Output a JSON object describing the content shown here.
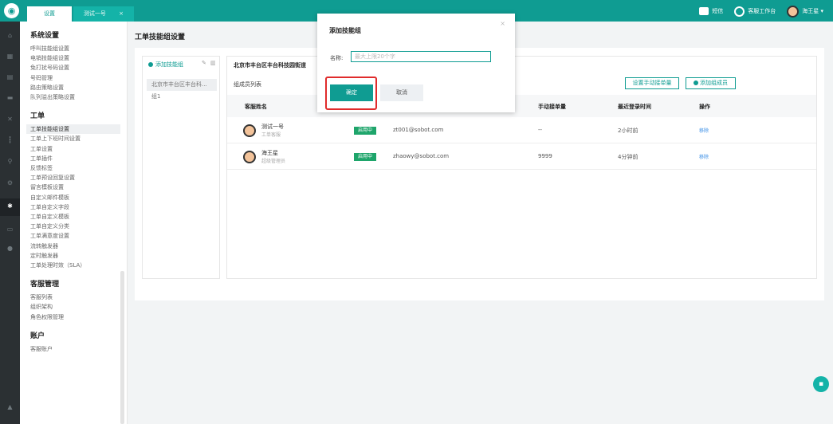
{
  "topbar": {
    "tabs": [
      {
        "label": "设置"
      },
      {
        "label": "测试一号",
        "close": "×"
      }
    ],
    "right": {
      "sms_label": "短信",
      "workbench_label": "客服工作台",
      "user_label": "海王星 ▾"
    }
  },
  "menu": {
    "sections": [
      {
        "title": "系统设置",
        "items": [
          "呼叫技能组设置",
          "电销技能组设置",
          "免打扰号码设置",
          "号码管理",
          "路由策略设置",
          "队列溢出策略设置"
        ]
      },
      {
        "title": "工单",
        "items": [
          "工单技能组设置",
          "工单上下班时间设置",
          "工单设置",
          "工单插件",
          "反馈标签",
          "工单预设回复设置",
          "留言模板设置",
          "自定义邮件模板",
          "工单自定义字段",
          "工单自定义模板",
          "工单自定义分类",
          "工单满意度设置",
          "流转触发器",
          "定时触发器",
          "工单处理时效（SLA）"
        ]
      },
      {
        "title": "客服管理",
        "items": [
          "客服列表",
          "组织架构",
          "角色权限管理"
        ]
      },
      {
        "title": "账户",
        "items": [
          "客服账户"
        ]
      }
    ],
    "active_item": "工单技能组设置"
  },
  "main": {
    "page_title": "工单技能组设置",
    "groups_panel": {
      "add_label": "添加技能组",
      "edit_icon": "✎",
      "delete_icon": "🗑",
      "items": [
        "北京市丰台区丰台科...",
        "组1"
      ]
    },
    "detail": {
      "title": "北京市丰台区丰台科技园街道",
      "members_label": "组成员列表",
      "set_tickets_button": "设置手动接单量",
      "add_member_button": "添加组成员",
      "columns": {
        "name": "客服姓名",
        "manual": "手动接单量",
        "last_login": "最近登录时间",
        "ops": "操作"
      },
      "rows": [
        {
          "name": "测试一号",
          "role": "工单客服",
          "status": "启用中",
          "email": "zt001@sobot.com",
          "manual": "--",
          "last_login": "2小时前",
          "action": "移除"
        },
        {
          "name": "海王星",
          "role": "超级管理员",
          "status": "启用中",
          "email": "zhaowy@sobot.com",
          "manual": "9999",
          "last_login": "4分钟前",
          "action": "移除"
        }
      ]
    }
  },
  "modal": {
    "title": "添加技能组",
    "close": "×",
    "name_label": "名称:",
    "name_placeholder": "最大上限20个字",
    "name_value": "",
    "ok_button": "确定",
    "cancel_button": "取消"
  },
  "colors": {
    "brand": "#0f9c92",
    "rail": "#2b3033",
    "status_green": "#1ea56b",
    "highlight": "#e02b2b",
    "link": "#3a8ee6"
  },
  "icons": {
    "logo": "logo-icon",
    "sms": "message-icon",
    "workbench": "headset-icon",
    "chat_fab": "chat-icon"
  }
}
